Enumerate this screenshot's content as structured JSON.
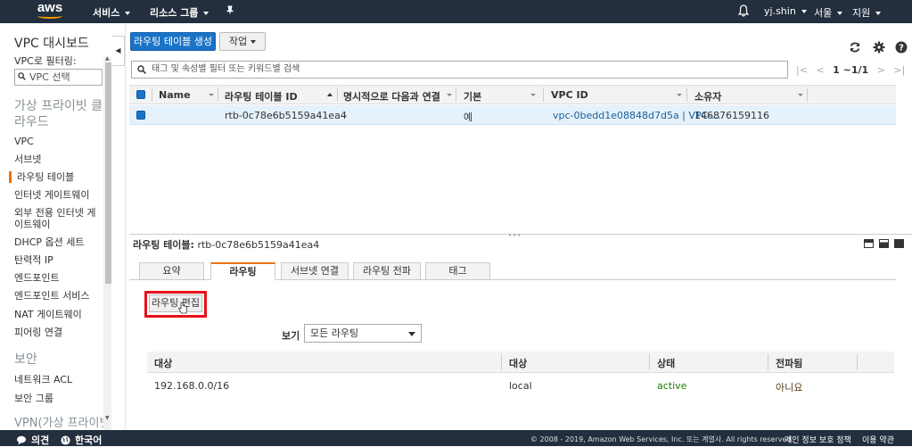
{
  "topnav": {
    "logo": "aws",
    "services": "서비스",
    "resource_groups": "리소스 그룹",
    "user": "yj.shin",
    "region": "서울",
    "support": "지원"
  },
  "sidebar": {
    "title": "VPC 대시보드",
    "filter_label": "VPC로 필터링:",
    "filter_value": "VPC 선택",
    "group_virtual": "가상 프라이빗 클라우드",
    "items": [
      "VPC",
      "서브넷",
      "라우팅 테이블",
      "인터넷 게이트웨이",
      "외부 전용 인터넷 게이트웨이",
      "DHCP 옵션 세트",
      "탄력적 IP",
      "엔드포인트",
      "엔드포인트 서비스",
      "NAT 게이트웨이",
      "피어링 연결"
    ],
    "group_security": "보안",
    "security_items": [
      "네트워크 ACL",
      "보안 그룹"
    ],
    "group_vpn": "VPN(가상 프라이빗"
  },
  "toolbar": {
    "create_label": "라우팅 테이블 생성",
    "action_label": "작업"
  },
  "search": {
    "placeholder": "태그 및 속성별 필터 또는 키워드별 검색"
  },
  "pager": {
    "range": "1 ~1/1"
  },
  "table": {
    "headers": [
      "Name",
      "라우팅 테이블 ID",
      "명시적으로 다음과 연결",
      "기본",
      "VPC ID",
      "소유자"
    ],
    "row": {
      "name": "",
      "route_table_id": "rtb-0c78e6b5159a41ea4",
      "explicit": "-",
      "main": "예",
      "vpc_id": "vpc-0bedd1e08848d7d5a | VPC-...",
      "owner": "146876159116"
    }
  },
  "detail": {
    "label": "라우팅 테이블:",
    "value": "rtb-0c78e6b5159a41ea4",
    "tabs": [
      "요약",
      "라우팅",
      "서브넷 연결",
      "라우팅 전파",
      "태그"
    ],
    "edit_label": "라우팅 편집",
    "view_label": "보기",
    "view_value": "모든 라우팅",
    "route_headers": [
      "대상",
      "대상",
      "상태",
      "전파됨"
    ],
    "route": {
      "destination": "192.168.0.0/16",
      "target": "local",
      "status": "active",
      "propagated": "아니요"
    }
  },
  "footer": {
    "feedback": "의견",
    "language": "한국어",
    "copyright": "© 2008 - 2019, Amazon Web Services, Inc. 또는 계열사. All rights reserved.",
    "privacy": "개인 정보 보호 정책",
    "terms": "이용 약관"
  },
  "colors": {
    "nav": "#232f3e",
    "primary": "#1a73c7",
    "accent": "#ec7211",
    "highlight": "#e8111b",
    "active": "#1d8102"
  }
}
